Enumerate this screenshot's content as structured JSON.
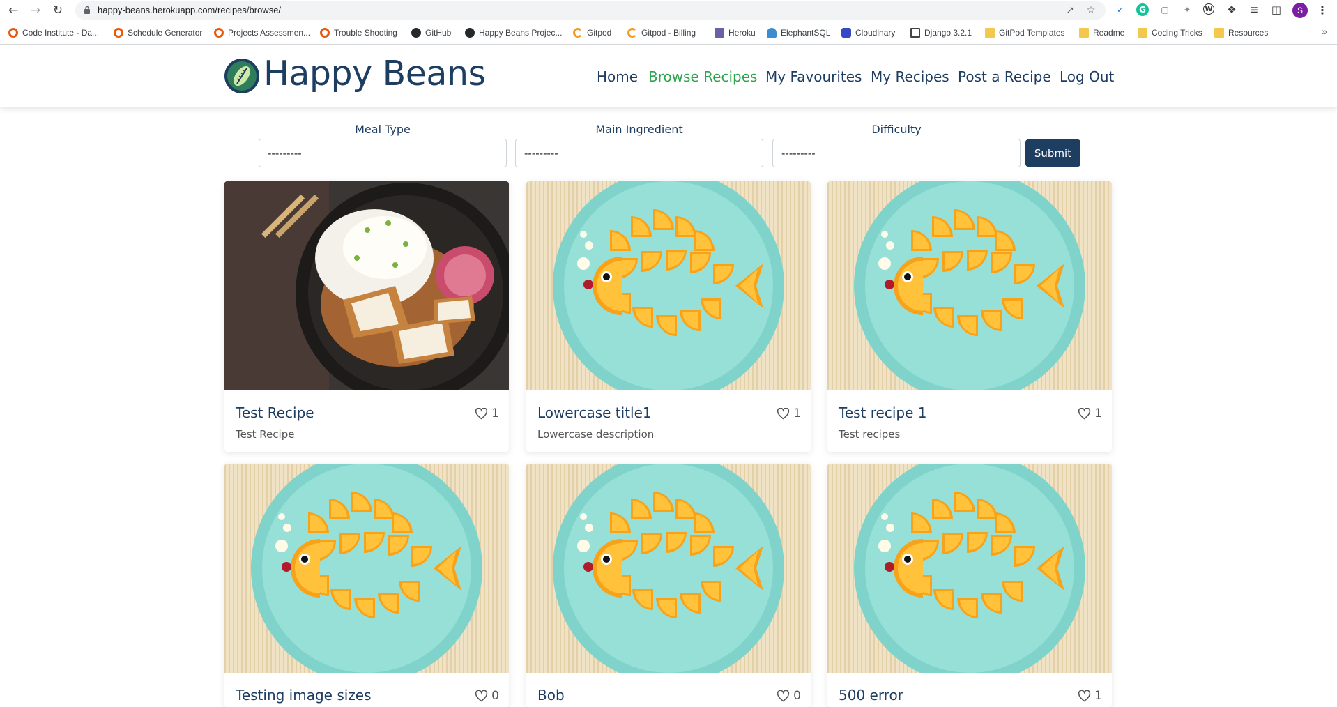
{
  "browser": {
    "url": "happy-beans.herokuapp.com/recipes/browse/",
    "profile_initial": "S",
    "bookmarks": [
      {
        "label": "Code Institute - Da...",
        "icon": "ring-icon"
      },
      {
        "label": "Schedule Generator",
        "icon": "ring-icon"
      },
      {
        "label": "Projects Assessmen...",
        "icon": "ring-icon"
      },
      {
        "label": "Trouble Shooting",
        "icon": "ring-icon"
      },
      {
        "label": "GitHub",
        "icon": "github-icon"
      },
      {
        "label": "Happy Beans Projec...",
        "icon": "github-icon"
      },
      {
        "label": "Gitpod",
        "icon": "gitpod-icon"
      },
      {
        "label": "Gitpod - Billing",
        "icon": "gitpod-icon"
      },
      {
        "label": "Heroku",
        "icon": "heroku-icon"
      },
      {
        "label": "ElephantSQL",
        "icon": "elephantsql-icon"
      },
      {
        "label": "Cloudinary",
        "icon": "cloudinary-icon"
      },
      {
        "label": "Django 3.2.1",
        "icon": "django-icon"
      },
      {
        "label": "GitPod Templates",
        "icon": "folder-icon"
      },
      {
        "label": "Readme",
        "icon": "folder-icon"
      },
      {
        "label": "Coding Tricks",
        "icon": "folder-icon"
      },
      {
        "label": "Resources",
        "icon": "folder-icon"
      }
    ]
  },
  "site": {
    "brand": "Happy Beans",
    "nav": [
      {
        "label": "Home",
        "active": false
      },
      {
        "label": "Browse Recipes",
        "active": true
      },
      {
        "label": "My Favourites",
        "active": false
      },
      {
        "label": "My Recipes",
        "active": false
      },
      {
        "label": "Post a Recipe",
        "active": false
      },
      {
        "label": "Log Out",
        "active": false
      }
    ],
    "colors": {
      "primary": "#1d3d61",
      "active": "#2ea44f"
    }
  },
  "filters": {
    "meal_type": {
      "label": "Meal Type",
      "value": "---------"
    },
    "main_ingredient": {
      "label": "Main Ingredient",
      "value": "---------"
    },
    "difficulty": {
      "label": "Difficulty",
      "value": "---------"
    },
    "submit_label": "Submit"
  },
  "recipes": [
    {
      "title": "Test Recipe",
      "description": "Test Recipe",
      "likes": "1",
      "image": "rice-bowl-image"
    },
    {
      "title": "Lowercase title1",
      "description": "Lowercase description",
      "likes": "1",
      "image": "orange-fish-image"
    },
    {
      "title": "Test recipe 1",
      "description": "Test recipes",
      "likes": "1",
      "image": "orange-fish-image"
    },
    {
      "title": "Testing image sizes",
      "description": "",
      "likes": "0",
      "image": "orange-fish-image"
    },
    {
      "title": "Bob",
      "description": "",
      "likes": "0",
      "image": "orange-fish-image"
    },
    {
      "title": "500 error",
      "description": "",
      "likes": "1",
      "image": "orange-fish-image"
    }
  ]
}
